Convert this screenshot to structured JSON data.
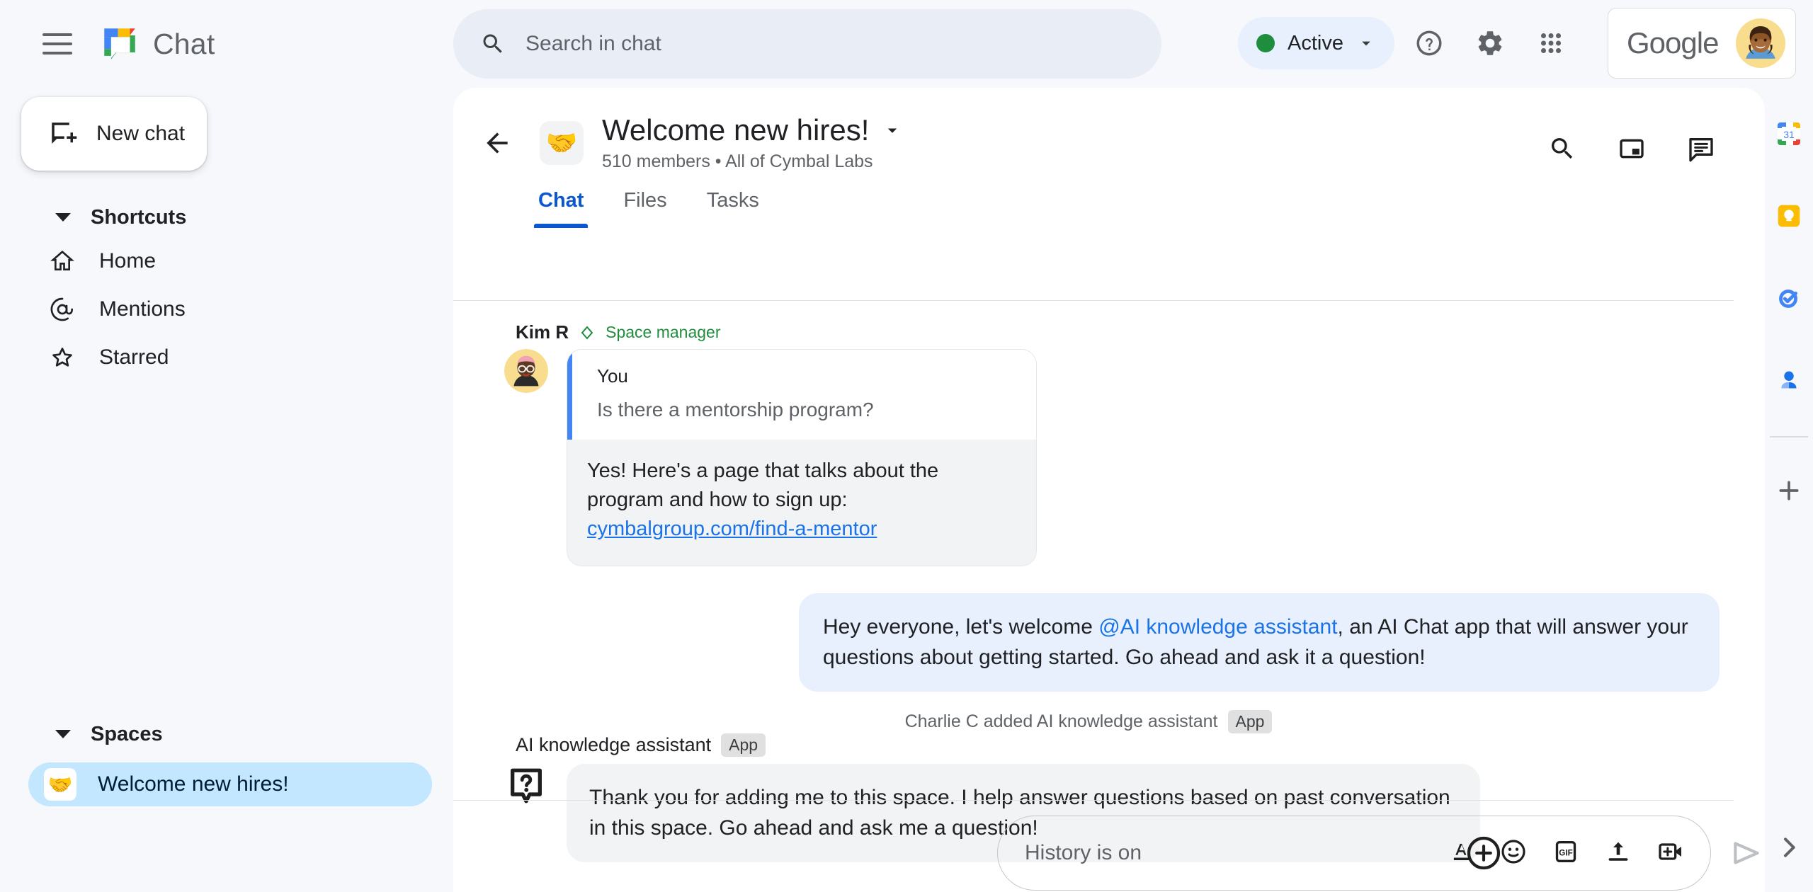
{
  "topbar": {
    "menu_icon": "hamburger-menu-icon",
    "product_logo": "google-chat-logo",
    "product_name": "Chat",
    "search": {
      "placeholder": "Search in chat",
      "value": "",
      "icon": "search-icon"
    },
    "status": {
      "label": "Active",
      "color": "#1e8e3e",
      "chevron": "chevron-down-icon"
    },
    "help_icon": "help-circle-icon",
    "settings_icon": "gear-icon",
    "apps_icon": "apps-grid-icon",
    "account": {
      "brand": "Google",
      "avatar": "user-avatar"
    }
  },
  "sidebar": {
    "new_chat": {
      "label": "New chat",
      "icon": "new-chat-icon"
    },
    "shortcuts": {
      "title": "Shortcuts",
      "items": [
        {
          "label": "Home",
          "icon": "home-icon"
        },
        {
          "label": "Mentions",
          "icon": "at-sign-icon"
        },
        {
          "label": "Starred",
          "icon": "star-icon"
        }
      ]
    },
    "spaces": {
      "title": "Spaces",
      "items": [
        {
          "label": "Welcome new hires!",
          "emoji": "🤝",
          "active": true
        }
      ]
    }
  },
  "space": {
    "back_icon": "back-arrow-icon",
    "emoji": "🤝",
    "title": "Welcome new hires!",
    "title_chevron": "chevron-down-icon",
    "subtitle": "510 members  •  All of Cymbal Labs",
    "actions": [
      {
        "icon": "search-icon",
        "name": "search-in-space-button"
      },
      {
        "icon": "picture-in-picture-icon",
        "name": "picture-in-picture-button"
      },
      {
        "icon": "threads-icon",
        "name": "threads-button"
      }
    ],
    "tabs": [
      {
        "label": "Chat",
        "active": true
      },
      {
        "label": "Files",
        "active": false
      },
      {
        "label": "Tasks",
        "active": false
      }
    ]
  },
  "messages": {
    "kim": {
      "author": "Kim R",
      "badge": "Space manager",
      "badge_icon": "diamond-icon",
      "avatar": "kim-avatar",
      "quoted": {
        "author": "You",
        "text": "Is there a mentorship program?"
      },
      "reply_text": "Yes! Here's a page that talks about the program and how to sign up: ",
      "reply_link": "cymbalgroup.com/find-a-mentor"
    },
    "welcome": {
      "before_mention": "Hey everyone, let's welcome ",
      "mention": "@AI knowledge assistant",
      "after_mention": ", an AI Chat app that will answer your questions about getting started.  Go ahead and ask it a question!"
    },
    "system": {
      "text": "Charlie C added AI knowledge assistant",
      "chip": "App"
    },
    "assistant": {
      "name": "AI knowledge assistant",
      "chip": "App",
      "avatar_icon": "question-bubble-icon",
      "text": "Thank you for adding me to this space. I help answer questions based on past conversation in this space. Go ahead and ask me a question!"
    }
  },
  "composer": {
    "plus_icon": "add-circle-icon",
    "placeholder": "History is on",
    "value": "",
    "tools": [
      {
        "icon": "format-text-icon",
        "name": "format-button"
      },
      {
        "icon": "emoji-icon",
        "name": "emoji-button"
      },
      {
        "icon": "gif-icon",
        "name": "gif-button"
      },
      {
        "icon": "upload-icon",
        "name": "upload-file-button"
      },
      {
        "icon": "add-video-icon",
        "name": "add-video-button"
      }
    ],
    "send_icon": "send-icon"
  },
  "rail": {
    "items": [
      {
        "icon": "google-calendar-icon",
        "name": "rail-calendar"
      },
      {
        "icon": "google-keep-icon",
        "name": "rail-keep"
      },
      {
        "icon": "google-tasks-icon",
        "name": "rail-tasks"
      },
      {
        "icon": "google-contacts-icon",
        "name": "rail-contacts"
      }
    ],
    "add_icon": "plus-icon",
    "expand_icon": "chevron-right-icon"
  },
  "colors": {
    "accent": "#0b57d0",
    "link": "#1a73e8",
    "active_green": "#1e8e3e",
    "space_active_bg": "#c2e7ff",
    "bubble_blue": "#e8f0fe",
    "bubble_gray": "#f1f3f4"
  }
}
